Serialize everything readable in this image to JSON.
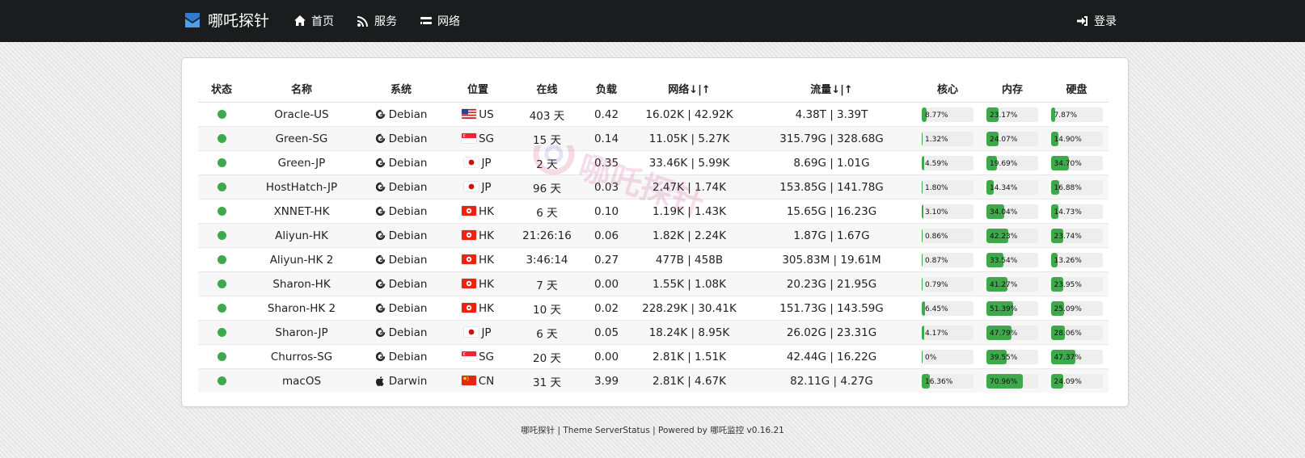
{
  "app": {
    "brand": "哪吒探针",
    "nav": [
      {
        "label": "首页",
        "icon": "home-icon"
      },
      {
        "label": "服务",
        "icon": "rss-icon"
      },
      {
        "label": "网络",
        "icon": "network-icon"
      }
    ],
    "login": {
      "label": "登录",
      "icon": "sign-in-icon"
    }
  },
  "table": {
    "headers": [
      "状态",
      "名称",
      "系统",
      "位置",
      "在线",
      "负载",
      "网络↓|↑",
      "流量↓|↑",
      "核心",
      "内存",
      "硬盘"
    ],
    "rows": [
      {
        "name": "Oracle-US",
        "os": "Debian",
        "os_icon": "debian-icon",
        "loc": "US",
        "flag": "us-flag-icon",
        "uptime": "403 天",
        "load": "0.42",
        "net": "16.02K | 42.92K",
        "traffic": "4.38T | 3.39T",
        "cpu": "8.77%",
        "mem": "23.17%",
        "disk": "7.87%"
      },
      {
        "name": "Green-SG",
        "os": "Debian",
        "os_icon": "debian-icon",
        "loc": "SG",
        "flag": "sg-flag-icon",
        "uptime": "15 天",
        "load": "0.14",
        "net": "11.05K | 5.27K",
        "traffic": "315.79G | 328.68G",
        "cpu": "1.32%",
        "mem": "24.07%",
        "disk": "14.90%"
      },
      {
        "name": "Green-JP",
        "os": "Debian",
        "os_icon": "debian-icon",
        "loc": "JP",
        "flag": "jp-flag-icon",
        "uptime": "2 天",
        "load": "0.35",
        "net": "33.46K | 5.99K",
        "traffic": "8.69G | 1.01G",
        "cpu": "4.59%",
        "mem": "19.69%",
        "disk": "34.70%"
      },
      {
        "name": "HostHatch-JP",
        "os": "Debian",
        "os_icon": "debian-icon",
        "loc": "JP",
        "flag": "jp-flag-icon",
        "uptime": "96 天",
        "load": "0.03",
        "net": "2.47K | 1.74K",
        "traffic": "153.85G | 141.78G",
        "cpu": "1.80%",
        "mem": "14.34%",
        "disk": "16.88%"
      },
      {
        "name": "XNNET-HK",
        "os": "Debian",
        "os_icon": "debian-icon",
        "loc": "HK",
        "flag": "hk-flag-icon",
        "uptime": "6 天",
        "load": "0.10",
        "net": "1.19K | 1.43K",
        "traffic": "15.65G | 16.23G",
        "cpu": "3.10%",
        "mem": "34.04%",
        "disk": "14.73%"
      },
      {
        "name": "Aliyun-HK",
        "os": "Debian",
        "os_icon": "debian-icon",
        "loc": "HK",
        "flag": "hk-flag-icon",
        "uptime": "21:26:16",
        "load": "0.06",
        "net": "1.82K | 2.24K",
        "traffic": "1.87G | 1.67G",
        "cpu": "0.86%",
        "mem": "42.23%",
        "disk": "23.74%"
      },
      {
        "name": "Aliyun-HK 2",
        "os": "Debian",
        "os_icon": "debian-icon",
        "loc": "HK",
        "flag": "hk-flag-icon",
        "uptime": "3:46:14",
        "load": "0.27",
        "net": "477B | 458B",
        "traffic": "305.83M | 19.61M",
        "cpu": "0.87%",
        "mem": "33.54%",
        "disk": "13.26%"
      },
      {
        "name": "Sharon-HK",
        "os": "Debian",
        "os_icon": "debian-icon",
        "loc": "HK",
        "flag": "hk-flag-icon",
        "uptime": "7 天",
        "load": "0.00",
        "net": "1.55K | 1.08K",
        "traffic": "20.23G | 21.95G",
        "cpu": "0.79%",
        "mem": "41.27%",
        "disk": "23.95%"
      },
      {
        "name": "Sharon-HK 2",
        "os": "Debian",
        "os_icon": "debian-icon",
        "loc": "HK",
        "flag": "hk-flag-icon",
        "uptime": "10 天",
        "load": "0.02",
        "net": "228.29K | 30.41K",
        "traffic": "151.73G | 143.59G",
        "cpu": "6.45%",
        "mem": "51.39%",
        "disk": "25.09%"
      },
      {
        "name": "Sharon-JP",
        "os": "Debian",
        "os_icon": "debian-icon",
        "loc": "JP",
        "flag": "jp-flag-icon",
        "uptime": "6 天",
        "load": "0.05",
        "net": "18.24K | 8.95K",
        "traffic": "26.02G | 23.31G",
        "cpu": "4.17%",
        "mem": "47.79%",
        "disk": "28.06%"
      },
      {
        "name": "Churros-SG",
        "os": "Debian",
        "os_icon": "debian-icon",
        "loc": "SG",
        "flag": "sg-flag-icon",
        "uptime": "20 天",
        "load": "0.00",
        "net": "2.81K | 1.51K",
        "traffic": "42.44G | 16.22G",
        "cpu": "0%",
        "mem": "39.55%",
        "disk": "47.37%"
      },
      {
        "name": "macOS",
        "os": "Darwin",
        "os_icon": "apple-icon",
        "loc": "CN",
        "flag": "cn-flag-icon",
        "uptime": "31 天",
        "load": "3.99",
        "net": "2.81K | 4.67K",
        "traffic": "82.11G | 4.27G",
        "cpu": "16.36%",
        "mem": "70.96%",
        "disk": "24.09%"
      }
    ]
  },
  "footer": "哪吒探针 | Theme ServerStatus | Powered by 哪吒监控 v0.16.21",
  "colors": {
    "navbar": "#1b1c1d",
    "online": "#3ea94b",
    "bar_bg": "#eeeeee"
  }
}
